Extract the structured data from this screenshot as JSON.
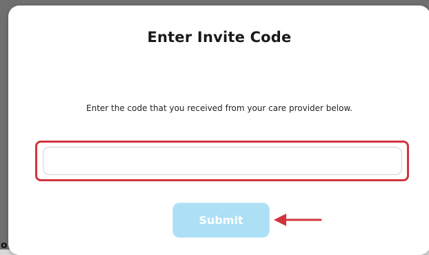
{
  "modal": {
    "title": "Enter Invite Code",
    "description": "Enter the code that you received from your care provider below.",
    "invite_code_value": "",
    "invite_code_placeholder": "",
    "submit_label": "Submit"
  },
  "backdrop": {
    "partial_glyph": "o"
  },
  "colors": {
    "annotation_red": "#d0343c",
    "submit_background": "#ade0f4",
    "submit_text": "#ffffff"
  },
  "icons": {
    "annotation_arrow": "left-arrow-icon"
  }
}
